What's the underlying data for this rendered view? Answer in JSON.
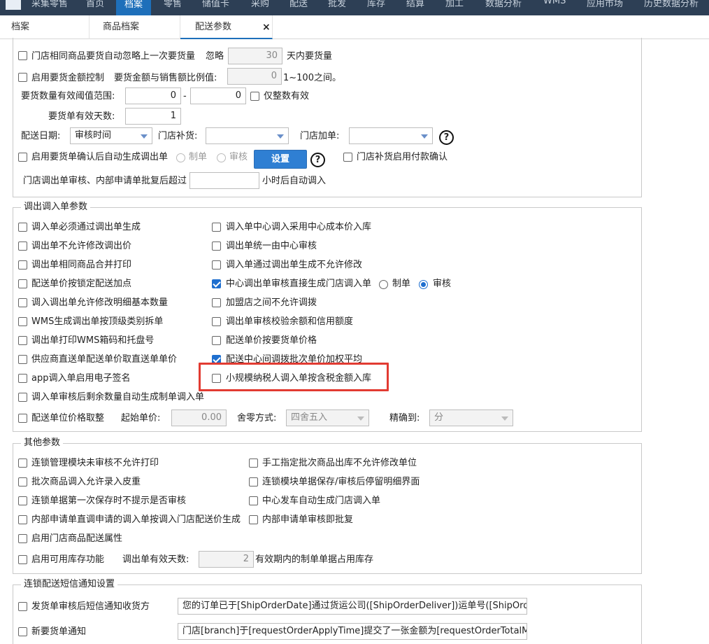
{
  "topnav": {
    "items": [
      "采集零售",
      "首页",
      "档案",
      "零售",
      "储值卡",
      "采购",
      "配送",
      "批发",
      "库存",
      "结算",
      "加工",
      "数据分析",
      "WMS",
      "应用市场",
      "历史数据分析"
    ],
    "active_index": 2
  },
  "tabs": [
    "档案",
    "商品档案",
    "配送参数"
  ],
  "tab_close": "×",
  "sec1": {
    "r1_label": "门店相同商品要货自动忽略上一次要货量",
    "r1_ignore": "忽略",
    "r1_days_value": "30",
    "r1_suffix": "天内要货量",
    "r2_label": "启用要货金额控制",
    "r2_ratio_label": "要货金额与销售额比例值:",
    "r2_ratio_value": "0",
    "r2_suffix": "1~100之间。",
    "r3_label": "要货数量有效阈值范围:",
    "r3_min": "0",
    "r3_dash": "-",
    "r3_max": "0",
    "r3_integer_label": "仅整数有效",
    "r4_label": "要货单有效天数:",
    "r4_value": "1",
    "r5_date_label": "配送日期:",
    "r5_date_value": "审核时间",
    "r5_restock_label": "门店补货:",
    "r5_restock_value": "",
    "r5_addorder_label": "门店加单:",
    "r5_addorder_value": "",
    "r6_label": "启用要货单确认后自动生成调出单",
    "r6_radio1": "制单",
    "r6_radio2": "审核",
    "r6_button": "设置",
    "r6_pay_label": "门店补货启用付款确认",
    "r7_label": "门店调出单审核、内部申请单批复后超过",
    "r7_value": "",
    "r7_suffix": "小时后自动调入"
  },
  "sec2": {
    "legend": "调出调入单参数",
    "left": [
      {
        "label": "调入单必须通过调出单生成",
        "checked": false
      },
      {
        "label": "调出单不允许修改调出价",
        "checked": false
      },
      {
        "label": "调出单相同商品合并打印",
        "checked": false
      },
      {
        "label": "配送单价按锁定配送加点",
        "checked": false
      },
      {
        "label": "调入调出单允许修改明细基本数量",
        "checked": false
      },
      {
        "label": "WMS生成调出单按顶级类别拆单",
        "checked": false
      },
      {
        "label": "调出单打印WMS箱码和托盘号",
        "checked": false
      },
      {
        "label": "供应商直送单配送单价取直送单单价",
        "checked": false
      },
      {
        "label": "app调入单启用电子签名",
        "checked": false
      },
      {
        "label": "调入单审核后剩余数量自动生成制单调入单",
        "checked": false
      }
    ],
    "right": [
      {
        "label": "调入单中心调入采用中心成本价入库",
        "checked": false
      },
      {
        "label": "调出单统一由中心审核",
        "checked": false
      },
      {
        "label": "调入单通过调出单生成不允许修改",
        "checked": false
      },
      {
        "label": "中心调出单审核直接生成门店调入单",
        "checked": true
      },
      {
        "label": "加盟店之间不允许调拨",
        "checked": false
      },
      {
        "label": "调出单审核校验余额和信用额度",
        "checked": false
      },
      {
        "label": "配送单价按要货单价格",
        "checked": false
      },
      {
        "label": "配送中心间调拨批次单价加权平均",
        "checked": true
      },
      {
        "label": "小规模纳税人调入单按含税金额入库",
        "checked": false
      }
    ],
    "radio_make": "制单",
    "radio_audit": "审核",
    "price_label": "配送单位价格取整",
    "start_price_label": "起始单价:",
    "start_price_value": "0.00",
    "rounding_label": "舍零方式:",
    "rounding_value": "四舍五入",
    "precision_label": "精确到:",
    "precision_value": "分"
  },
  "sec3": {
    "legend": "其他参数",
    "left": [
      {
        "label": "连锁管理模块未审核不允许打印",
        "checked": false
      },
      {
        "label": "批次商品调入允许录入皮重",
        "checked": false
      },
      {
        "label": "连锁单据第一次保存时不提示是否审核",
        "checked": false
      },
      {
        "label": "内部申请单直调申请的调入单按调入门店配送价生成",
        "checked": false
      },
      {
        "label": "启用门店商品配送属性",
        "checked": false
      }
    ],
    "right": [
      {
        "label": "手工指定批次商品出库不允许修改单位",
        "checked": false
      },
      {
        "label": "连锁模块单据保存/审核后停留明细界面",
        "checked": false
      },
      {
        "label": "中心发车自动生成门店调入单",
        "checked": false
      },
      {
        "label": "内部申请单审核即批复",
        "checked": false
      }
    ],
    "stock_label": "启用可用库存功能",
    "days_label": "调出单有效天数:",
    "days_value": "2",
    "days_suffix": "有效期内的制单单据占用库存"
  },
  "sec4": {
    "legend": "连锁配送短信通知设置",
    "r1_label": "发货单审核后短信通知收货方",
    "r1_value": "您的订单已于[ShipOrderDate]通过货运公司([ShipOrderDeliver])运单号([ShipOrderBill",
    "r2_label": "新要货单通知",
    "r2_value": "门店[branch]于[requestOrderApplyTime]提交了一张金额为[requestOrderTotalMoney],"
  },
  "colors": {
    "accent": "#1e6fcf",
    "nav_bg": "#2d3f55",
    "highlight": "#e23b32"
  }
}
